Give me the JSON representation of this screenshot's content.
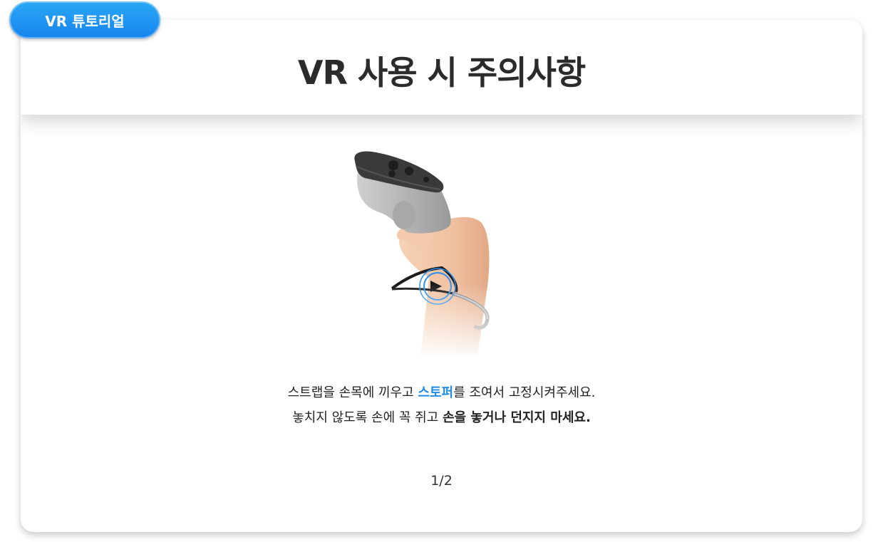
{
  "badge": {
    "label": "VR 튜토리얼"
  },
  "header": {
    "title": "VR 사용 시 주의사항"
  },
  "illustration": {
    "icon": "vr-controller-strap-icon"
  },
  "instructions": {
    "line1": {
      "part1": "스트랩을 손목에 끼우고 ",
      "highlight": "스토퍼",
      "part2": "를 조여서 고정시켜주세요."
    },
    "line2": {
      "part1": "놓치지 않도록 손에 꼭 쥐고 ",
      "bold": "손을 놓거나 던지지 마세요."
    }
  },
  "pagination": {
    "indicator": "1/2"
  },
  "colors": {
    "accent": "#1f8de8",
    "badge_top": "#2aa8f5",
    "badge_bottom": "#1684ee",
    "title": "#2b2b2b"
  }
}
